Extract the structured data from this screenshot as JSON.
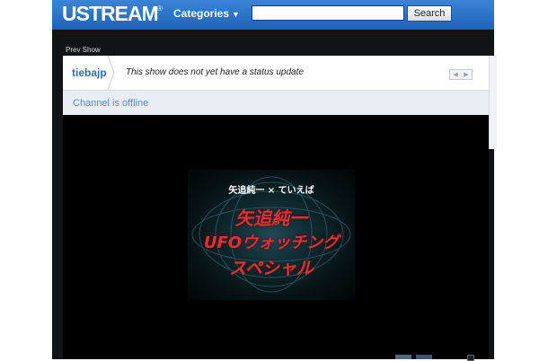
{
  "header": {
    "logo": "USTREAM",
    "logo_mark": "®",
    "categories_label": "Categories",
    "search": {
      "value": "",
      "placeholder": ""
    },
    "search_button": "Search"
  },
  "channel": {
    "prev_show": "Prev Show",
    "name": "tiebajp",
    "status_text": "This show does not yet have a status update",
    "offline_text": "Channel is offline"
  },
  "video": {
    "top_text": "矢追純一 × ていえば",
    "title_lines": [
      "矢追純一",
      "UFOウォッチング",
      "スペシャル"
    ]
  },
  "icons": {
    "categories": "chevron-down-icon",
    "pager_prev": "arrow-left-icon",
    "pager_next": "arrow-right-icon"
  },
  "colors": {
    "header_blue": "#2a70c4",
    "link_blue": "#2b6fbf",
    "offline_bg": "#e9eef5",
    "title_red": "#d6343a"
  }
}
